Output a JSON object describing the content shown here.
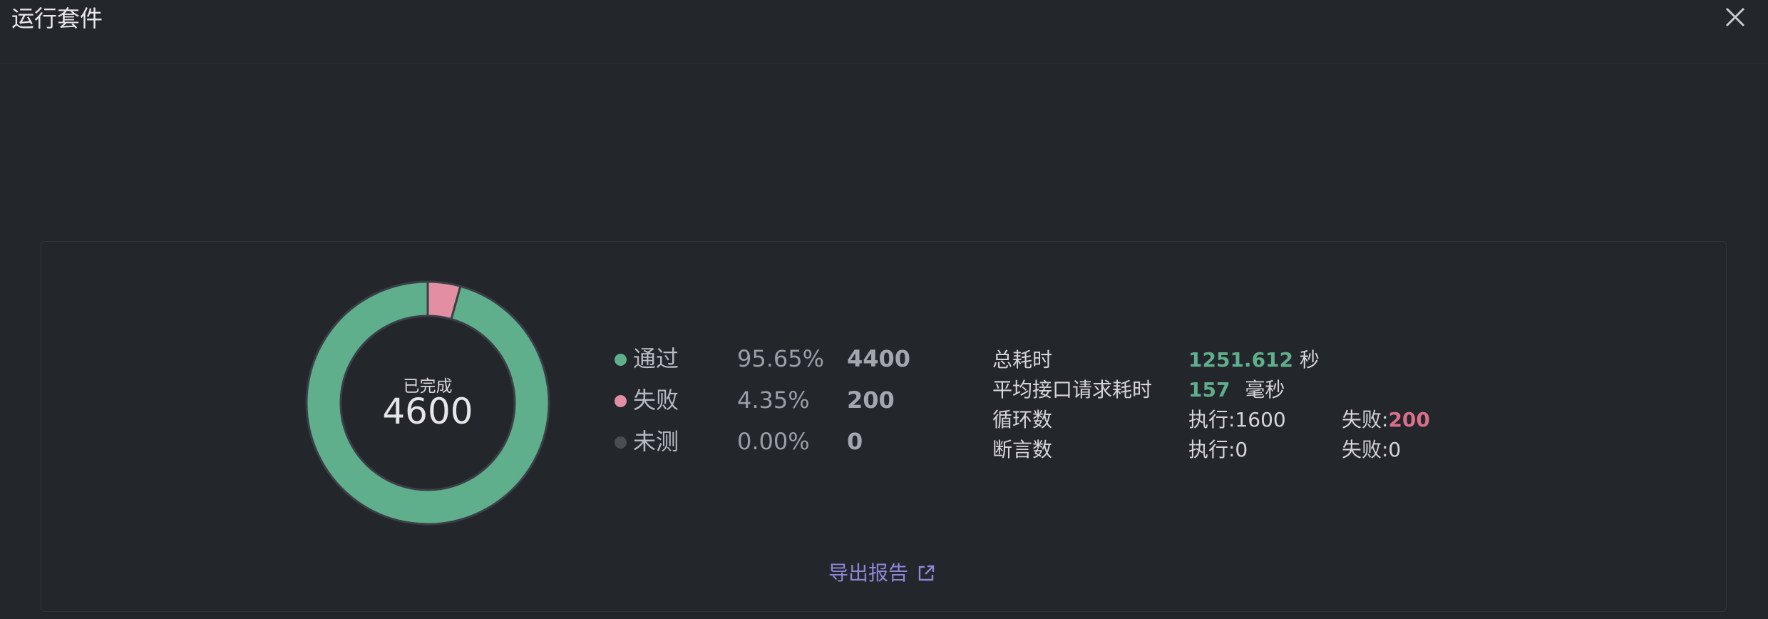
{
  "header": {
    "title": "运行套件"
  },
  "summary": {
    "center_label": "已完成",
    "center_value": "4600"
  },
  "legend": [
    {
      "name": "通过",
      "pct": "95.65%",
      "count": "4400",
      "color": "#5fae8c"
    },
    {
      "name": "失败",
      "pct": "4.35%",
      "count": "200",
      "color": "#e28fa3"
    },
    {
      "name": "未测",
      "pct": "0.00%",
      "count": "0",
      "color": "#4a4d53"
    }
  ],
  "chart_data": {
    "type": "pie",
    "categories": [
      "通过",
      "失败",
      "未测"
    ],
    "values": [
      4400,
      200,
      0
    ],
    "colors": [
      "#5fae8c",
      "#e28fa3",
      "#4a4d53"
    ]
  },
  "stats": {
    "total_time_label": "总耗时",
    "total_time_value": "1251.612",
    "total_time_unit": "秒",
    "avg_req_label": "平均接口请求耗时",
    "avg_req_value": "157",
    "avg_req_unit": "毫秒",
    "loops_label": "循环数",
    "loops_exec": "执行:1600",
    "loops_fail_label": "失败:",
    "loops_fail_value": "200",
    "asserts_label": "断言数",
    "asserts_exec": "执行:0",
    "asserts_fail": "失败:0"
  },
  "actions": {
    "export_label": "导出报告"
  }
}
